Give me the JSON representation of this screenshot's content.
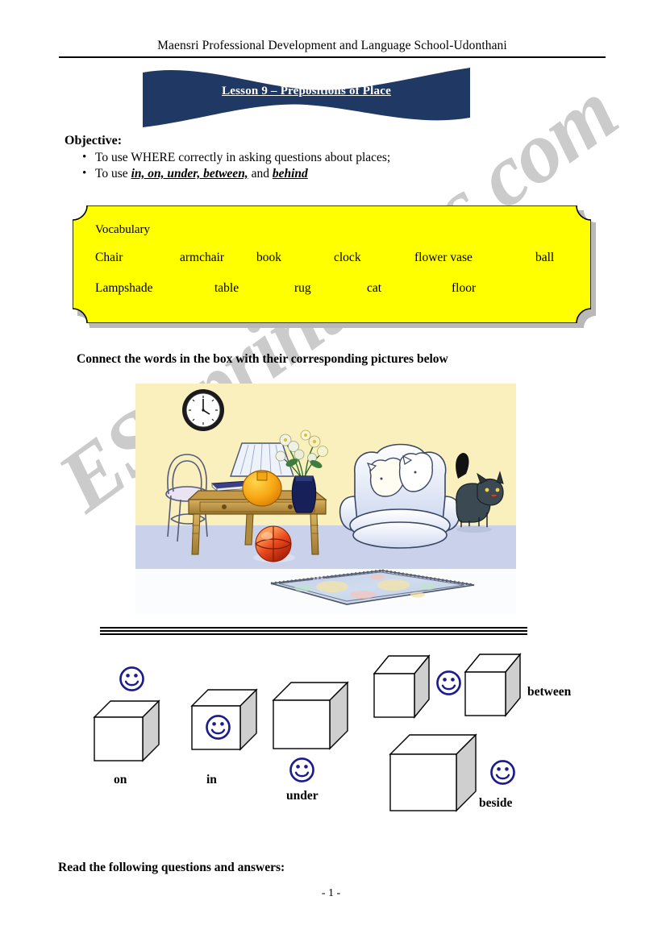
{
  "document": {
    "school_header": "Maensri Professional Development and Language School-Udonthani",
    "banner_title": "Lesson 9 – Prepositions of Place",
    "page_number": "- 1 -",
    "watermark": "ESLprintables.com"
  },
  "objective": {
    "title": "Objective:",
    "items": [
      {
        "pre": "To use WHERE correctly in asking questions about places;",
        "em": "",
        "post": ""
      },
      {
        "pre": "To use ",
        "em": "in, on, under, between,",
        "mid": " and ",
        "em2": "behind",
        "post": ""
      }
    ]
  },
  "vocabulary": {
    "label": "Vocabulary",
    "row1": [
      "Chair",
      "armchair",
      "book",
      "clock",
      "flower vase",
      "ball"
    ],
    "row2": [
      "Lampshade",
      "table",
      "rug",
      "cat",
      "floor"
    ]
  },
  "instructions": {
    "connect": "Connect the words in the box with their corresponding pictures below",
    "read": "Read the following questions and answers:"
  },
  "prepositions": [
    {
      "label": "on"
    },
    {
      "label": "in"
    },
    {
      "label": "under"
    },
    {
      "label": "between"
    },
    {
      "label": "beside"
    }
  ],
  "room_scene": {
    "objects": [
      "clock",
      "chair",
      "table",
      "book",
      "lampshade",
      "flower vase",
      "ball",
      "armchair",
      "cat",
      "rug",
      "floor"
    ]
  },
  "colors": {
    "banner_navy": "#1F3864",
    "vocab_yellow": "#FFFF00",
    "smiley_blue": "#1B1B8F",
    "cube_side_gray": "#CFCFCF",
    "wall_yellow": "#FAF0BE",
    "floor_blue": "#C9D2EA",
    "watermark_gray": "#C9C9C9"
  }
}
